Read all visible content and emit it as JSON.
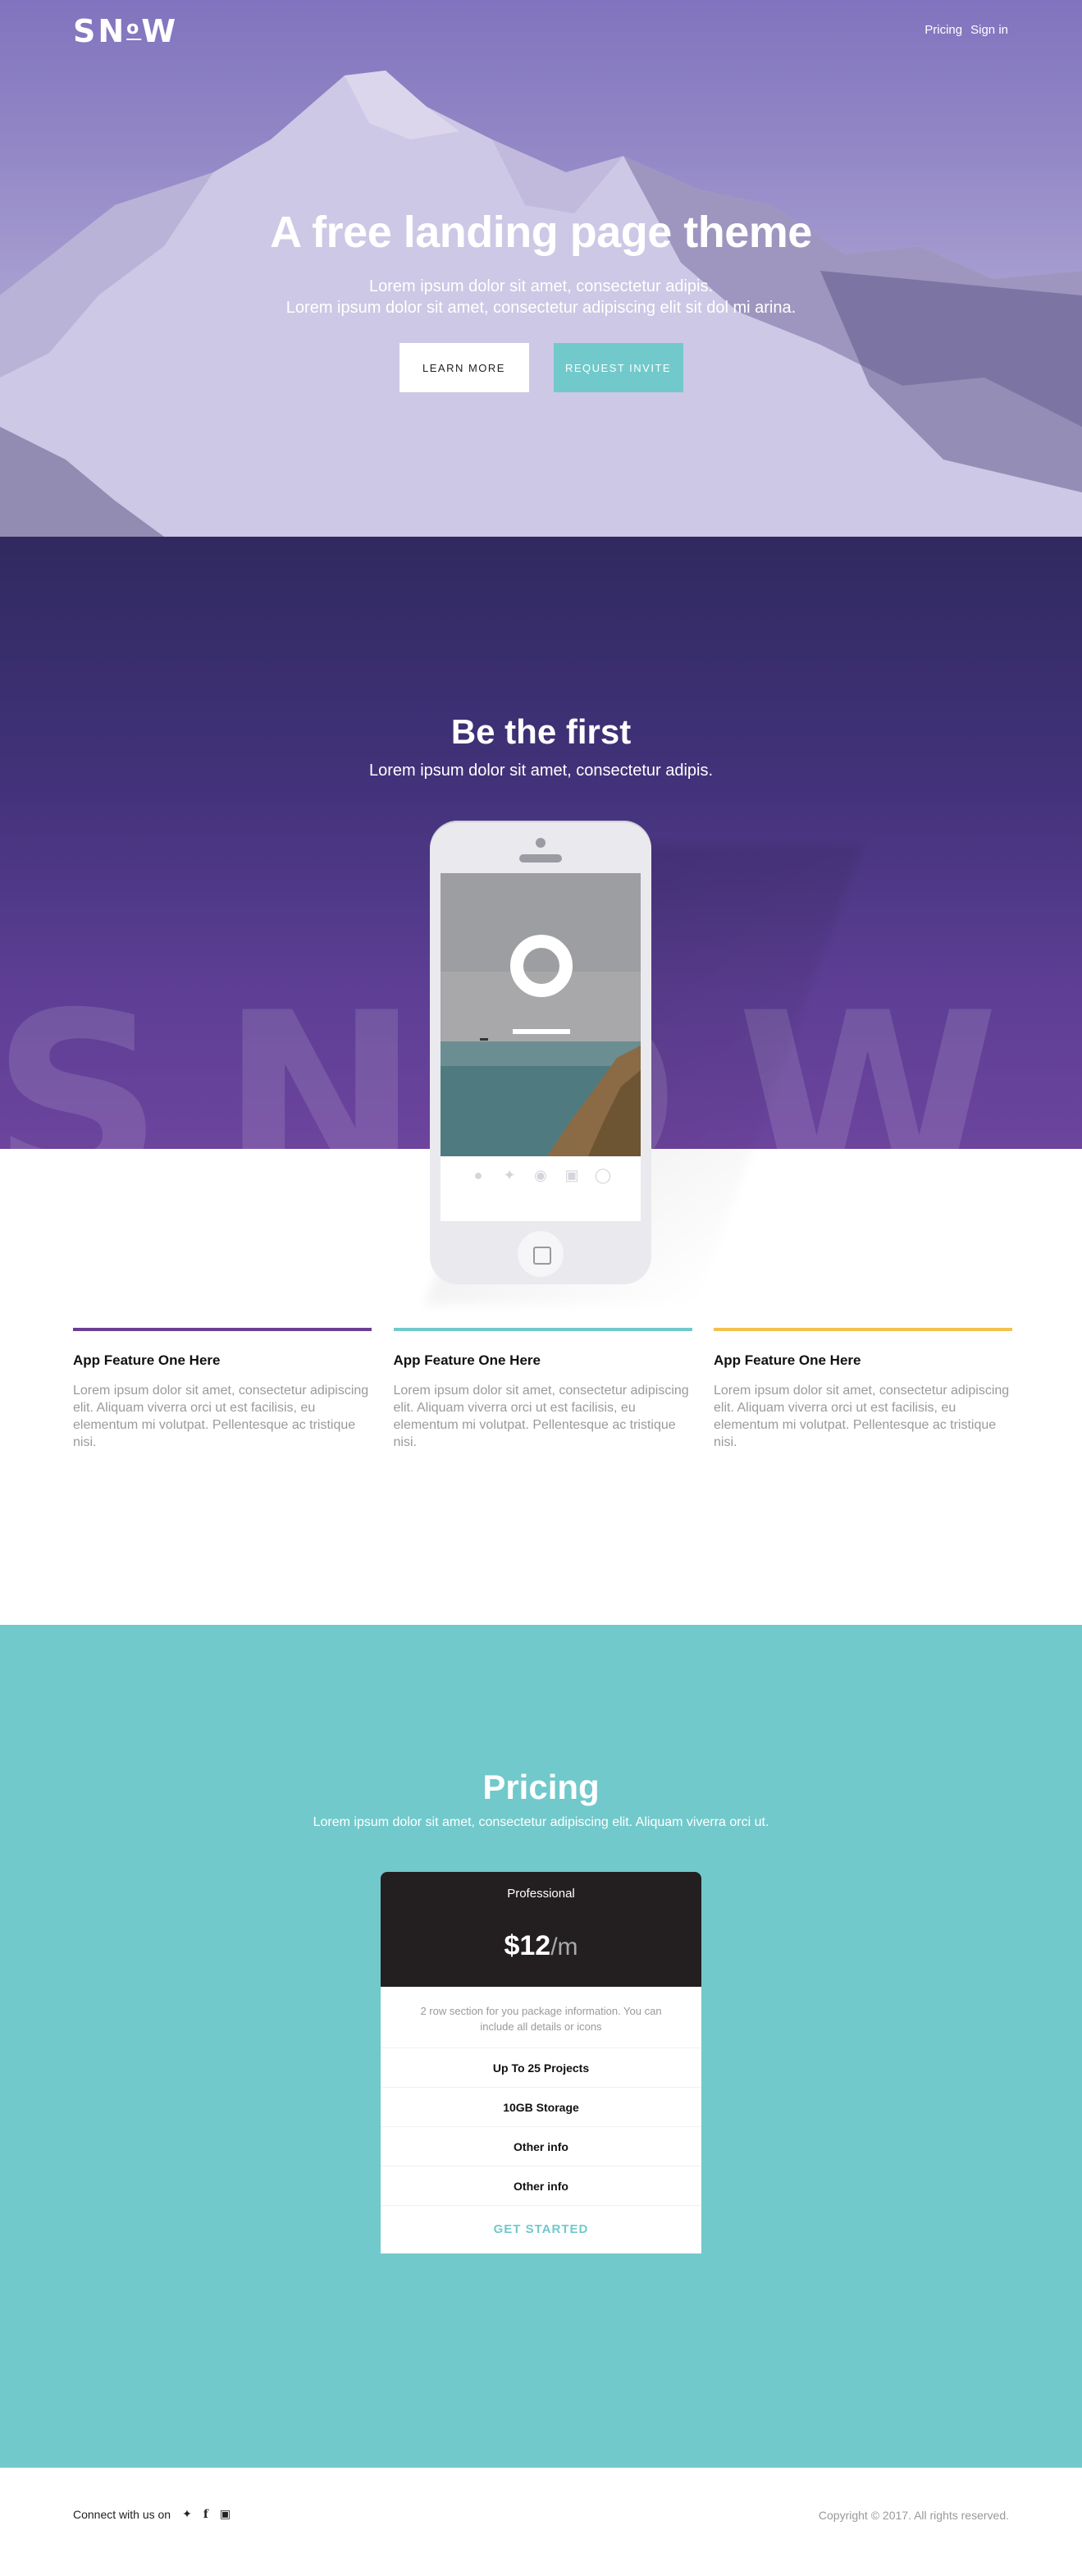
{
  "header": {
    "logo": "SNoW",
    "logo_parts": [
      "SN",
      "o",
      "W"
    ],
    "nav": [
      "Pricing",
      "Sign in"
    ]
  },
  "hero": {
    "title": "A free landing page theme",
    "subtitle_line1": "Lorem ipsum dolor sit amet, consectetur adipis.",
    "subtitle_line2": "Lorem ipsum dolor sit amet, consectetur adipiscing elit sit dol mi arina.",
    "btn_learn": "LEARN MORE",
    "btn_invite": "REQUEST INVITE"
  },
  "first": {
    "title": "Be the first",
    "subtitle": "Lorem ipsum dolor sit amet, consectetur adipis.",
    "watermark": "SNOW"
  },
  "phone": {
    "icons": [
      "user-icon",
      "twitter-icon",
      "facebook-icon",
      "instagram-icon",
      "skype-icon"
    ]
  },
  "features": [
    {
      "title": "App Feature One Here",
      "text": "Lorem ipsum dolor sit amet, consectetur adipiscing elit. Aliquam viverra orci ut est facilisis, eu elementum mi volutpat. Pellentesque ac tristique nisi.",
      "color": "#6a3f92"
    },
    {
      "title": "App Feature One Here",
      "text": "Lorem ipsum dolor sit amet, consectetur adipiscing elit. Aliquam viverra orci ut est facilisis, eu elementum mi volutpat. Pellentesque ac tristique nisi.",
      "color": "#71c9cb"
    },
    {
      "title": "App Feature One Here",
      "text": "Lorem ipsum dolor sit amet, consectetur adipiscing elit. Aliquam viverra orci ut est facilisis, eu elementum mi volutpat. Pellentesque ac tristique nisi.",
      "color": "#f2c14e"
    }
  ],
  "pricing": {
    "title": "Pricing",
    "subtitle": "Lorem ipsum dolor sit amet, consectetur adipiscing elit. Aliquam viverra orci ut.",
    "plan": "Professional",
    "price": "$12",
    "per": "/m",
    "description": "2 row section for you package information. You can include all details or icons",
    "items": [
      "Up To 25 Projects",
      "10GB Storage",
      "Other info",
      "Other info"
    ],
    "cta": "GET STARTED"
  },
  "footer": {
    "connect": "Connect with us on",
    "social": [
      "twitter-icon",
      "facebook-icon",
      "instagram-icon"
    ],
    "copyright": "Copyright © 2017. All rights reserved."
  },
  "colors": {
    "accent_teal": "#71c9cb",
    "purple": "#6a3f92",
    "dark": "#231f21",
    "yellow": "#f2c14e"
  }
}
